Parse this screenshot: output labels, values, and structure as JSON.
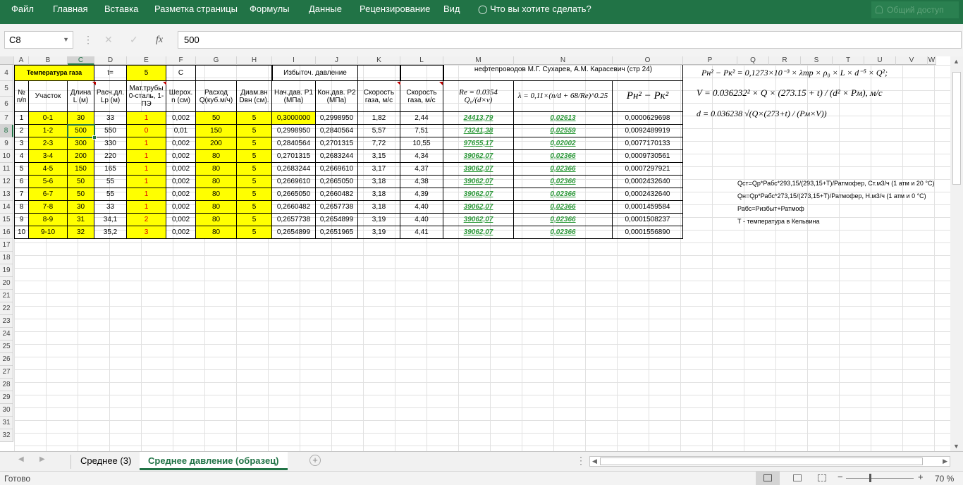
{
  "ribbon": {
    "tabs": [
      "Файл",
      "Главная",
      "Вставка",
      "Разметка страницы",
      "Формулы",
      "Данные",
      "Рецензирование",
      "Вид"
    ],
    "tell_me": "Что вы хотите сделать?",
    "share": "Общий доступ"
  },
  "formula_bar": {
    "name_box": "C8",
    "value": "500",
    "fx": "fx"
  },
  "columns": [
    "A",
    "B",
    "C",
    "D",
    "E",
    "F",
    "G",
    "H",
    "I",
    "J",
    "K",
    "L",
    "M",
    "N",
    "O",
    "P",
    "Q",
    "R",
    "S",
    "T",
    "U",
    "V",
    "W"
  ],
  "rows": [
    "4",
    "5",
    "6",
    "7",
    "8",
    "9",
    "10",
    "11",
    "12",
    "13",
    "14",
    "15",
    "16",
    "17",
    "18",
    "19",
    "20",
    "21",
    "22",
    "23",
    "24",
    "25",
    "26",
    "27",
    "28",
    "29",
    "30",
    "31",
    "32"
  ],
  "top": {
    "gas_temp": "Температура газа",
    "t_label": "t=",
    "t_value": "5",
    "unit": "С",
    "excess_pressure": "Избыточ. давление",
    "source": "нефтепроводов  М.Г. Сухарев, А.М. Карасевич (стр 24)"
  },
  "headers": {
    "a": "№ п/п",
    "b": "Участок",
    "c": "Длина L (м)",
    "d": "Расч.дл. Lр (м)",
    "e": "Мат.трубы 0-сталь, 1-ПЭ",
    "f": "Шерох. n (см)",
    "g": "Расход Q(куб.м/ч)",
    "h": "Диам.вн Dвн (см).",
    "i": "Нач.дав. P1 (МПа)",
    "j": "Кон.дав. P2 (МПа)",
    "k": "Скорость газа, м/с",
    "l": "Скорость газа, м/с",
    "m": "Re = 0.0354 Q₀/(d×v)",
    "n": "λ = 0,11×(n/d + 68/Re)^0.25",
    "o": "Pн² − Pк²"
  },
  "table": [
    {
      "n": "1",
      "seg": "0-1",
      "L": "30",
      "Lr": "33",
      "mat": "1",
      "rough": "0,002",
      "Q": "50",
      "D": "5",
      "P1": "0,3000000",
      "P2": "0,2998950",
      "v1": "1,82",
      "v2": "2,44",
      "Re": "24413,79",
      "lam": "0,02613",
      "dp": "0,0000629698"
    },
    {
      "n": "2",
      "seg": "1-2",
      "L": "500",
      "Lr": "550",
      "mat": "0",
      "rough": "0,01",
      "Q": "150",
      "D": "5",
      "P1": "0,2998950",
      "P2": "0,2840564",
      "v1": "5,57",
      "v2": "7,51",
      "Re": "73241,38",
      "lam": "0,02559",
      "dp": "0,0092489919"
    },
    {
      "n": "3",
      "seg": "2-3",
      "L": "300",
      "Lr": "330",
      "mat": "1",
      "rough": "0,002",
      "Q": "200",
      "D": "5",
      "P1": "0,2840564",
      "P2": "0,2701315",
      "v1": "7,72",
      "v2": "10,55",
      "Re": "97655,17",
      "lam": "0,02002",
      "dp": "0,0077170133"
    },
    {
      "n": "4",
      "seg": "3-4",
      "L": "200",
      "Lr": "220",
      "mat": "1",
      "rough": "0,002",
      "Q": "80",
      "D": "5",
      "P1": "0,2701315",
      "P2": "0,2683244",
      "v1": "3,15",
      "v2": "4,34",
      "Re": "39062,07",
      "lam": "0,02366",
      "dp": "0,0009730561"
    },
    {
      "n": "5",
      "seg": "4-5",
      "L": "150",
      "Lr": "165",
      "mat": "1",
      "rough": "0,002",
      "Q": "80",
      "D": "5",
      "P1": "0,2683244",
      "P2": "0,2669610",
      "v1": "3,17",
      "v2": "4,37",
      "Re": "39062,07",
      "lam": "0,02366",
      "dp": "0,0007297921"
    },
    {
      "n": "6",
      "seg": "5-6",
      "L": "50",
      "Lr": "55",
      "mat": "1",
      "rough": "0,002",
      "Q": "80",
      "D": "5",
      "P1": "0,2669610",
      "P2": "0,2665050",
      "v1": "3,18",
      "v2": "4,38",
      "Re": "39062,07",
      "lam": "0,02366",
      "dp": "0,0002432640"
    },
    {
      "n": "7",
      "seg": "6-7",
      "L": "50",
      "Lr": "55",
      "mat": "1",
      "rough": "0,002",
      "Q": "80",
      "D": "5",
      "P1": "0,2665050",
      "P2": "0,2660482",
      "v1": "3,18",
      "v2": "4,39",
      "Re": "39062,07",
      "lam": "0,02366",
      "dp": "0,0002432640"
    },
    {
      "n": "8",
      "seg": "7-8",
      "L": "30",
      "Lr": "33",
      "mat": "1",
      "rough": "0,002",
      "Q": "80",
      "D": "5",
      "P1": "0,2660482",
      "P2": "0,2657738",
      "v1": "3,18",
      "v2": "4,40",
      "Re": "39062,07",
      "lam": "0,02366",
      "dp": "0,0001459584"
    },
    {
      "n": "9",
      "seg": "8-9",
      "L": "31",
      "Lr": "34,1",
      "mat": "2",
      "rough": "0,002",
      "Q": "80",
      "D": "5",
      "P1": "0,2657738",
      "P2": "0,2654899",
      "v1": "3,19",
      "v2": "4,40",
      "Re": "39062,07",
      "lam": "0,02366",
      "dp": "0,0001508237"
    },
    {
      "n": "10",
      "seg": "9-10",
      "L": "32",
      "Lr": "35,2",
      "mat": "3",
      "rough": "0,002",
      "Q": "80",
      "D": "5",
      "P1": "0,2654899",
      "P2": "0,2651965",
      "v1": "3,19",
      "v2": "4,41",
      "Re": "39062,07",
      "lam": "0,02366",
      "dp": "0,0001556890"
    }
  ],
  "formulas": {
    "f1": "Pн² − Pк² = 0,1273×10⁻³ × λтр × ρ₀ × L × d⁻⁵ × Q²;",
    "f2": "V = 0.036232² × Q × (273.15 + t) / (d² × Pм), м/с",
    "f3": "d = 0.036238 √(Q×(273+t) / (Pм×V))"
  },
  "notes": [
    "Qст=Qр*Рабс*293,15/(293,15+Т)/Ратмофер, Ст.м3/ч (1 атм и 20 °С)",
    "Qн=Qр*Рабс*273,15/(273,15+Т)/Ратмофер, Н.м3/ч (1 атм и 0 °С)",
    "Рабс=Ризбыт+Ратмоф",
    "Т - температура в Кельвина"
  ],
  "sheet_tabs": {
    "tab1": "Среднее (3)",
    "tab2": "Среднее давление (образец)"
  },
  "status": {
    "ready": "Готово",
    "zoom": "70 %"
  }
}
